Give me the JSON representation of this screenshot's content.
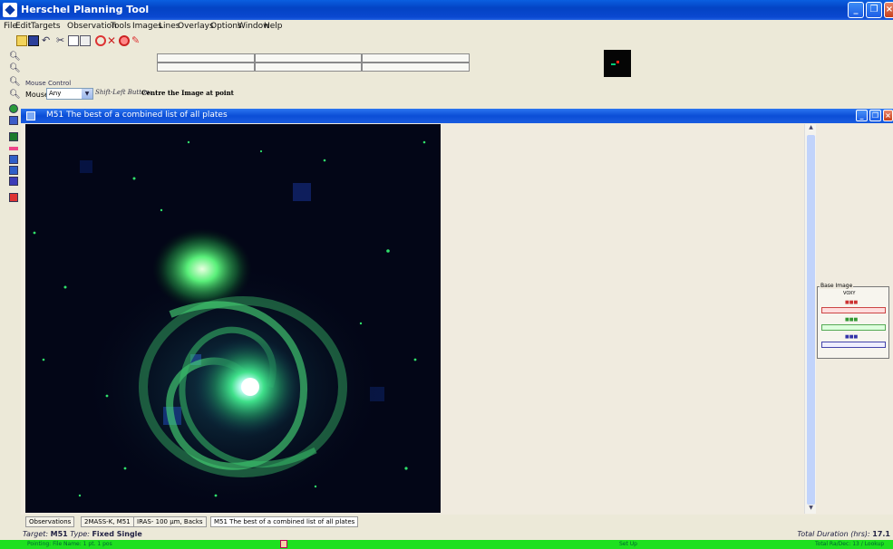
{
  "window": {
    "title": "Herschel Planning Tool"
  },
  "menu": [
    "File",
    "Edit",
    "Targets",
    "Observation",
    "Tools",
    "Images",
    "Lines",
    "Overlays",
    "Options",
    "Window",
    "Help"
  ],
  "mouse_control": {
    "group_title": "Mouse Control",
    "mouse_label": "Mouse:",
    "mouse_value": "Any",
    "hint_button": "Shift-Left Button:",
    "hint_action": "Centre the Image at point"
  },
  "image_frame": {
    "title": "M51  The best of a combined list of all plates"
  },
  "base_image_panel": {
    "title": "Base Image",
    "label": "VOXY"
  },
  "tabs": [
    {
      "label": "Observations"
    },
    {
      "label": "2MASS-K, M51"
    },
    {
      "label": "IRAS- 100 μm, Backs"
    },
    {
      "label": "M51 The best of a combined list of all plates"
    }
  ],
  "info": {
    "target_label": "Target:",
    "target_value": "M51",
    "type_label": "Type:",
    "type_value": "Fixed Single",
    "duration_label": "Total Duration (hrs):",
    "duration_value": "17.1"
  },
  "status": {
    "left": "Pointing: File Name: 1 pt. 1 pos",
    "middle": "Set Up",
    "right": "Total Ra/Dec: 13 / Lookup"
  },
  "colors": {
    "title_bar": "#0343c4",
    "status_bar": "#1ee020",
    "sky_background": "#020515"
  }
}
